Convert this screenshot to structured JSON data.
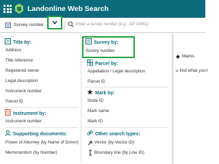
{
  "app": {
    "title": "Landonline Web Search"
  },
  "searchbar": {
    "search_type": "Survey number",
    "placeholder": "Enter a survey number (e.g., DP 15451)"
  },
  "background": {
    "marks_label": "Marks",
    "partial_text": "u find what you'r"
  },
  "dropdown": {
    "title_by": {
      "header": "Title by:",
      "items": [
        "Address",
        "Title reference",
        "Registered owner",
        "Legal description",
        "Instrument number",
        "Parcel ID"
      ]
    },
    "instrument_by": {
      "header": "Instrument by:",
      "items": [
        "Instrument number"
      ]
    },
    "supporting_documents": {
      "header": "Supporting documents:",
      "items": [
        "Power of Attorney (by Name of Donor)",
        "Memorandum (by Number)"
      ]
    },
    "survey_by": {
      "header": "Survey by:",
      "items": [
        "Survey number"
      ]
    },
    "parcel_by": {
      "header": "Parcel by:",
      "items": [
        "Appellation / Legal description",
        "Parcel ID"
      ]
    },
    "mark_by": {
      "header": "Mark by:",
      "items": [
        "Node ID",
        "Mark name",
        "Mark ID"
      ]
    },
    "other_search_types": {
      "header": "Other search types:",
      "items": [
        "Vector (by Vector ID)",
        "Boundary line (by Line ID)"
      ]
    }
  },
  "colors": {
    "topbar": "#0b6b7a",
    "heading": "#0b6b7a",
    "highlight": "#1e9e3c",
    "instrument_icon": "#c0392b"
  },
  "icons": [
    "grid-icon",
    "logo-icon",
    "document-icon",
    "chevron-down-icon",
    "search-icon",
    "map-icon",
    "user-icon",
    "parcel-icon",
    "star-icon",
    "link-icon",
    "arrow-up-right-icon",
    "boundary-line-icon"
  ]
}
